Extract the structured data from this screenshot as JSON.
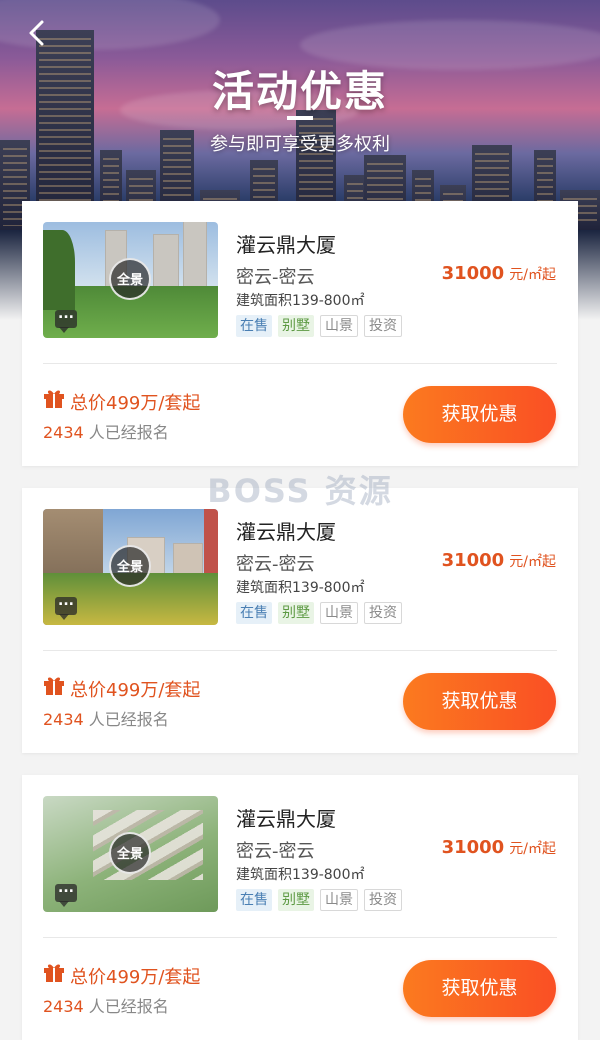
{
  "header": {
    "title": "活动优惠",
    "subtitle": "参与即可享受更多权利"
  },
  "watermark": "BOSS 资源",
  "listings": [
    {
      "name": "灌云鼎大厦",
      "region": "密云-密云",
      "area": "建筑面积139-800㎡",
      "price": "31000",
      "price_unit": "元/㎡起",
      "vr_label": "全景",
      "tags": [
        {
          "label": "在售",
          "style": "blue"
        },
        {
          "label": "别墅",
          "style": "green"
        },
        {
          "label": "山景",
          "style": "gray"
        },
        {
          "label": "投资",
          "style": "gray"
        }
      ],
      "total_price": "总价499万/套起",
      "signup_count": "2434",
      "signup_text": " 人已经报名",
      "cta_label": "获取优惠"
    },
    {
      "name": "灌云鼎大厦",
      "region": "密云-密云",
      "area": "建筑面积139-800㎡",
      "price": "31000",
      "price_unit": "元/㎡起",
      "vr_label": "全景",
      "tags": [
        {
          "label": "在售",
          "style": "blue"
        },
        {
          "label": "别墅",
          "style": "green"
        },
        {
          "label": "山景",
          "style": "gray"
        },
        {
          "label": "投资",
          "style": "gray"
        }
      ],
      "total_price": "总价499万/套起",
      "signup_count": "2434",
      "signup_text": " 人已经报名",
      "cta_label": "获取优惠"
    },
    {
      "name": "灌云鼎大厦",
      "region": "密云-密云",
      "area": "建筑面积139-800㎡",
      "price": "31000",
      "price_unit": "元/㎡起",
      "vr_label": "全景",
      "tags": [
        {
          "label": "在售",
          "style": "blue"
        },
        {
          "label": "别墅",
          "style": "green"
        },
        {
          "label": "山景",
          "style": "gray"
        },
        {
          "label": "投资",
          "style": "gray"
        }
      ],
      "total_price": "总价499万/套起",
      "signup_count": "2434",
      "signup_text": " 人已经报名",
      "cta_label": "获取优惠"
    }
  ],
  "colors": {
    "accent": "#e0531f",
    "cta_start": "#fb7a1f",
    "cta_end": "#fa4f24"
  }
}
